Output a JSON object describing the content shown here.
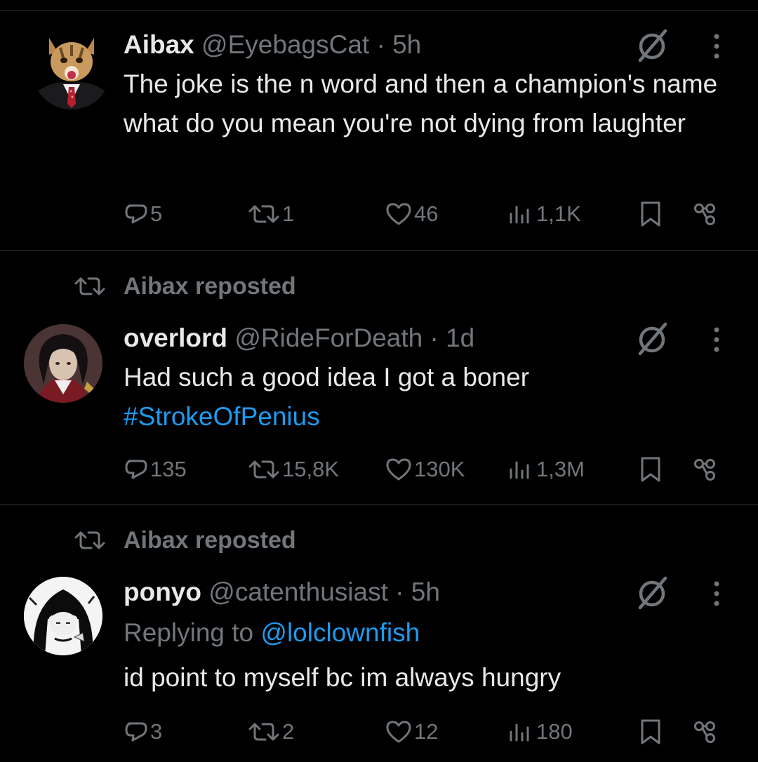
{
  "tweets": [
    {
      "repost_label": "",
      "name": "Aibax",
      "handle": "@EyebagsCat",
      "time": "· 5h",
      "replying_prefix": "",
      "replying_to": "",
      "text": "The joke is the n word and then a champion's name what do you mean you're not dying from laughter",
      "hashtag": "",
      "stats": {
        "replies": "5",
        "reposts": "1",
        "likes": "46",
        "views": "1,1K"
      }
    },
    {
      "repost_label": "Aibax reposted",
      "name": "overlord",
      "handle": "@RideForDeath",
      "time": "· 1d",
      "replying_prefix": "",
      "replying_to": "",
      "text": "Had such a good idea I got a boner",
      "hashtag": "#StrokeOfPenius",
      "stats": {
        "replies": "135",
        "reposts": "15,8K",
        "likes": "130K",
        "views": "1,3M"
      }
    },
    {
      "repost_label": "Aibax reposted",
      "name": "ponyo",
      "handle": "@catenthusiast",
      "time": "· 5h",
      "replying_prefix": "Replying to ",
      "replying_to": "@lolclownfish",
      "text": "id point to myself bc im always hungry",
      "hashtag": "",
      "stats": {
        "replies": "3",
        "reposts": "2",
        "likes": "12",
        "views": "180"
      }
    }
  ],
  "icons": {
    "reply": "reply-icon",
    "repost": "repost-icon",
    "like": "heart-icon",
    "views": "views-icon",
    "bookmark": "bookmark-icon",
    "share": "share-icon",
    "grok": "grok-icon",
    "more": "more-icon"
  },
  "colors": {
    "background": "#000000",
    "text": "#e7e9ea",
    "muted": "#71767b",
    "link": "#1d9bf0",
    "divider": "#2f3336"
  }
}
